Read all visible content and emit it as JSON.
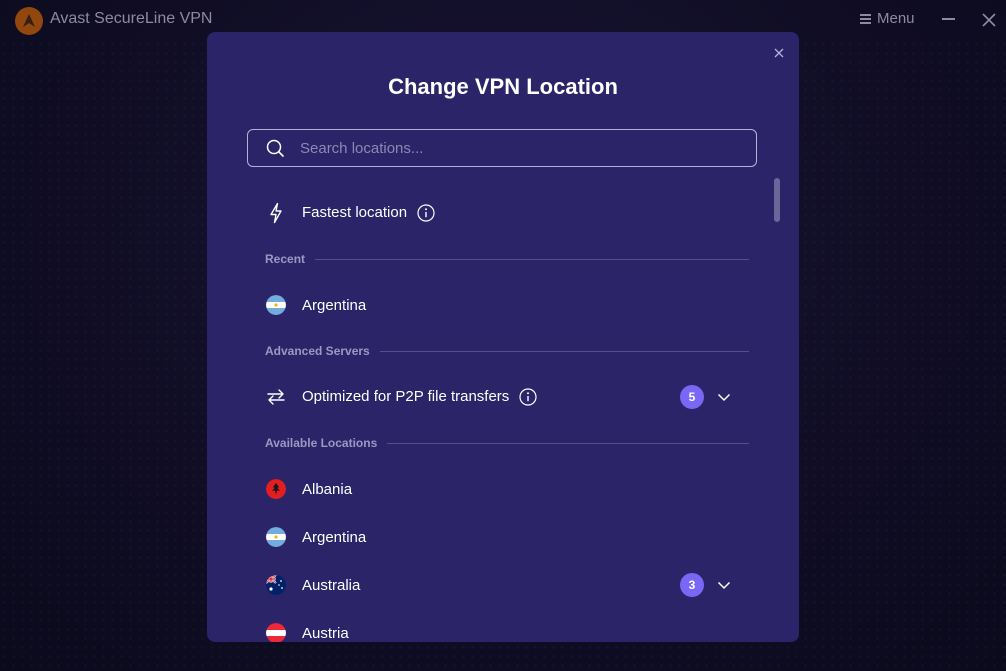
{
  "app": {
    "title": "Avast SecureLine VPN",
    "menu_label": "Menu"
  },
  "modal": {
    "title": "Change VPN Location",
    "search": {
      "placeholder": "Search locations...",
      "value": ""
    },
    "fastest": {
      "label": "Fastest location",
      "icon": "lightning-icon"
    },
    "sections": {
      "recent": "Recent",
      "advanced": "Advanced Servers",
      "available": "Available Locations"
    },
    "recent_items": [
      {
        "label": "Argentina",
        "flag": "argentina-flag-icon"
      }
    ],
    "advanced_items": [
      {
        "label": "Optimized for P2P file transfers",
        "count": "5",
        "icon": "transfer-arrows-icon"
      }
    ],
    "available_items": [
      {
        "label": "Albania",
        "flag": "albania-flag-icon"
      },
      {
        "label": "Argentina",
        "flag": "argentina-flag-icon"
      },
      {
        "label": "Australia",
        "flag": "australia-flag-icon",
        "count": "3"
      },
      {
        "label": "Austria",
        "flag": "austria-flag-icon"
      }
    ]
  },
  "colors": {
    "background": "#0d0b1f",
    "modal": "#2c2468",
    "badge": "#7a67f5",
    "muted_text": "#9d98c2"
  }
}
